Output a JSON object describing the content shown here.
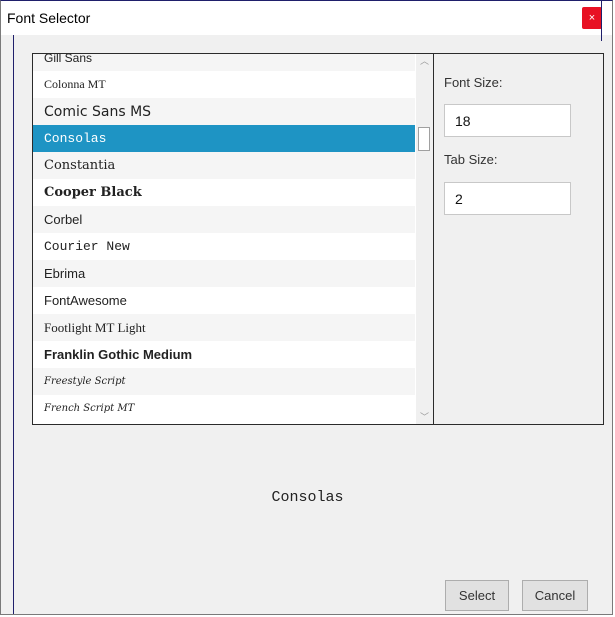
{
  "window": {
    "title": "Font Selector",
    "close_glyph": "×"
  },
  "font_list": {
    "items": [
      {
        "label": "Gill Sans",
        "font": "\"Liberation Sans\", sans-serif",
        "size": "12px",
        "weight": "normal",
        "style": "normal",
        "selected": false
      },
      {
        "label": "Colonna MT",
        "font": "\"Liberation Serif\", serif",
        "size": "12px",
        "weight": "normal",
        "style": "normal",
        "selected": false
      },
      {
        "label": "Comic Sans MS",
        "font": "\"DejaVu Sans\", sans-serif",
        "size": "14px",
        "weight": "normal",
        "style": "normal",
        "selected": false
      },
      {
        "label": "Consolas",
        "font": "\"Liberation Mono\", monospace",
        "size": "13px",
        "weight": "normal",
        "style": "normal",
        "selected": true
      },
      {
        "label": "Constantia",
        "font": "\"DejaVu Serif\", serif",
        "size": "13px",
        "weight": "normal",
        "style": "normal",
        "selected": false
      },
      {
        "label": "Cooper Black",
        "font": "\"DejaVu Serif\", serif",
        "size": "13px",
        "weight": "bold",
        "style": "normal",
        "selected": false
      },
      {
        "label": "Corbel",
        "font": "\"Liberation Sans\", sans-serif",
        "size": "13px",
        "weight": "normal",
        "style": "normal",
        "selected": false
      },
      {
        "label": "Courier New",
        "font": "\"Liberation Mono\", monospace",
        "size": "13px",
        "weight": "normal",
        "style": "normal",
        "selected": false
      },
      {
        "label": "Ebrima",
        "font": "\"Liberation Sans\", sans-serif",
        "size": "13px",
        "weight": "normal",
        "style": "normal",
        "selected": false
      },
      {
        "label": "FontAwesome",
        "font": "\"Liberation Sans\", sans-serif",
        "size": "13px",
        "weight": "normal",
        "style": "normal",
        "selected": false
      },
      {
        "label": "Footlight MT Light",
        "font": "\"Liberation Serif\", serif",
        "size": "13px",
        "weight": "normal",
        "style": "normal",
        "selected": false
      },
      {
        "label": "Franklin Gothic Medium",
        "font": "\"Liberation Sans\", sans-serif",
        "size": "13px",
        "weight": "bold",
        "style": "normal",
        "selected": false
      },
      {
        "label": "Freestyle Script",
        "font": "\"DejaVu Serif\", serif",
        "size": "10px",
        "weight": "normal",
        "style": "italic",
        "selected": false
      },
      {
        "label": "French Script MT",
        "font": "\"DejaVu Serif\", serif",
        "size": "10px",
        "weight": "normal",
        "style": "italic",
        "selected": false
      }
    ]
  },
  "scrollbar": {
    "up_glyph": "︿",
    "down_glyph": "﹀"
  },
  "options": {
    "font_size_label": "Font Size:",
    "font_size_value": "18",
    "tab_size_label": "Tab Size:",
    "tab_size_value": "2"
  },
  "preview": {
    "text": "Consolas"
  },
  "buttons": {
    "select_label": "Select",
    "cancel_label": "Cancel"
  },
  "colors": {
    "selection": "#1e94c4",
    "close_button": "#e81123",
    "border": "#2b2b2b"
  }
}
